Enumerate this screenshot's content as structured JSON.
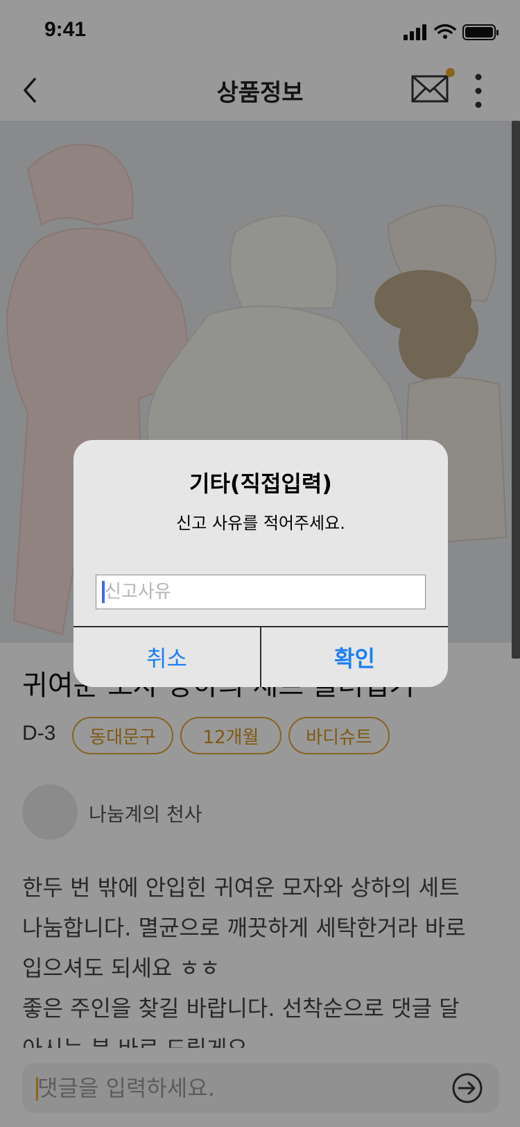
{
  "status_bar": {
    "time": "9:41"
  },
  "header": {
    "title": "상품정보",
    "back_icon": "chevron-left-icon",
    "mail_icon": "envelope-icon",
    "more_icon": "more-vertical-icon"
  },
  "product": {
    "title": "귀여운 모자 상하의 세트 물려입기",
    "dday": "D-3",
    "tags": [
      "동대문구",
      "12개월",
      "바디슈트"
    ],
    "author": "나눔계의 천사",
    "description_lines": [
      "한두 번 밖에 안입힌 귀여운 모자와 상하의 세트",
      "나눔합니다. 멸균으로 깨끗하게 세탁한거라 바로",
      "입으셔도 되세요 ㅎㅎ",
      "좋은 주인을 찾길 바랍니다. 선착순으로 댓글 달",
      "아시는 분 바로 드릴게요"
    ]
  },
  "comment": {
    "placeholder": "댓글을 입력하세요.",
    "send_icon": "send-arrow-icon"
  },
  "dialog": {
    "title": "기타(직접입력)",
    "message": "신고 사유를 적어주세요.",
    "input_placeholder": "신고사유",
    "cancel_label": "취소",
    "confirm_label": "확인"
  },
  "colors": {
    "accent": "#e8a92e",
    "tag_border": "#e3a63a",
    "dialog_button": "#1a7ff5",
    "caret": "#3e6be0"
  }
}
